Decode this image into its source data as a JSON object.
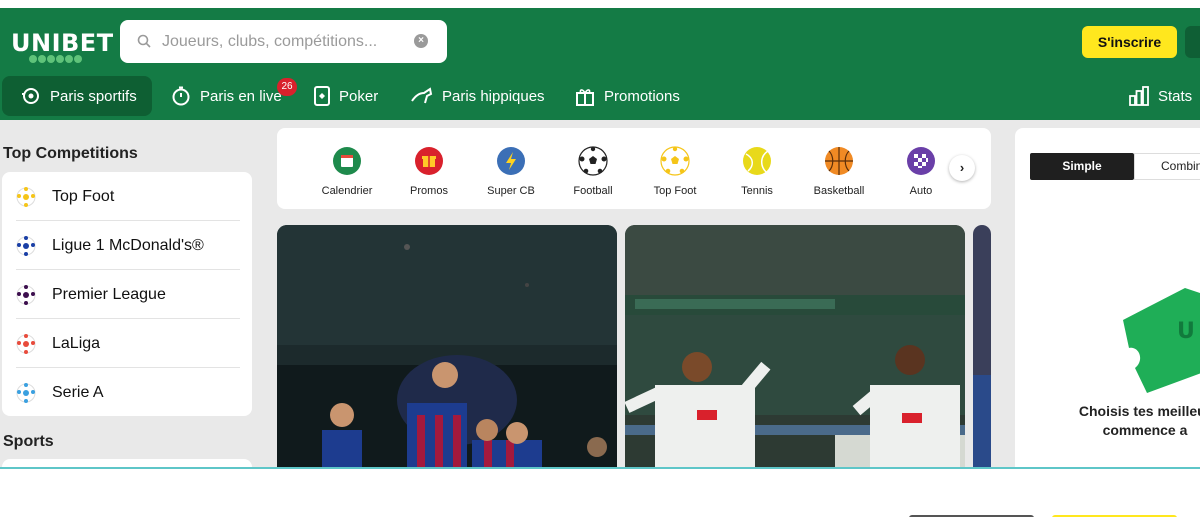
{
  "brand": {
    "name": "UNIBET",
    "green": "#147b45",
    "yellow": "#ffe71e"
  },
  "search": {
    "placeholder": "Joueurs, clubs, compétitions..."
  },
  "header": {
    "signup_label": "S'inscrire"
  },
  "nav": {
    "items": [
      {
        "label": "Paris sportifs",
        "icon": "ball-spin-icon",
        "active": true
      },
      {
        "label": "Paris en live",
        "icon": "stopwatch-icon",
        "badge": "26"
      },
      {
        "label": "Poker",
        "icon": "card-icon"
      },
      {
        "label": "Paris hippiques",
        "icon": "horse-icon"
      },
      {
        "label": "Promotions",
        "icon": "gift-icon"
      },
      {
        "label": "Stats",
        "icon": "bar-chart-icon"
      }
    ]
  },
  "sidebar": {
    "top_title": "Top Competitions",
    "competitions": [
      {
        "label": "Top Foot",
        "icon": "football-yellow-icon"
      },
      {
        "label": "Ligue 1 McDonald's®",
        "icon": "football-blue-icon"
      },
      {
        "label": "Premier League",
        "icon": "football-purple-icon"
      },
      {
        "label": "LaLiga",
        "icon": "football-red-icon"
      },
      {
        "label": "Serie A",
        "icon": "football-lightblue-icon"
      }
    ],
    "sports_title": "Sports"
  },
  "categories": [
    {
      "label": "Calendrier",
      "icon": "calendar-icon"
    },
    {
      "label": "Promos",
      "icon": "promo-gift-icon"
    },
    {
      "label": "Super CB",
      "icon": "lightning-icon"
    },
    {
      "label": "Football",
      "icon": "football-icon"
    },
    {
      "label": "Top Foot",
      "icon": "top-foot-icon"
    },
    {
      "label": "Tennis",
      "icon": "tennis-ball-icon"
    },
    {
      "label": "Basketball",
      "icon": "basketball-icon"
    },
    {
      "label": "Auto",
      "icon": "checkered-flag-icon"
    }
  ],
  "betslip": {
    "tab_simple": "Simple",
    "tab_combi": "Combin",
    "message_line1": "Choisis tes meilleur",
    "message_line2": "commence a"
  }
}
